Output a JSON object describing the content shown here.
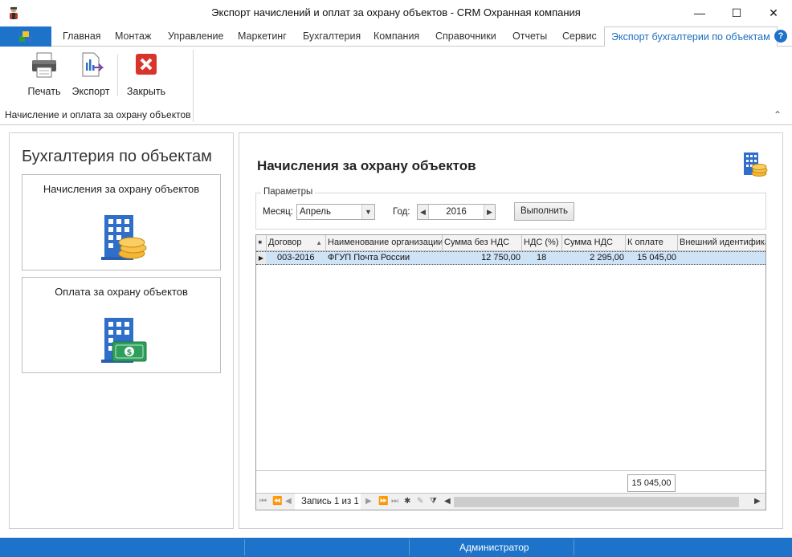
{
  "window": {
    "title": "Экспорт начислений и оплат за охрану объектов - CRM Охранная компания",
    "minimize_glyph": "—",
    "maximize_glyph": "☐",
    "close_glyph": "✕"
  },
  "tabs": [
    {
      "label": "Главная"
    },
    {
      "label": "Монтаж"
    },
    {
      "label": "Управление"
    },
    {
      "label": "Маркетинг"
    },
    {
      "label": "Бухгалтерия"
    },
    {
      "label": "Компания"
    },
    {
      "label": "Справочники"
    },
    {
      "label": "Отчеты"
    },
    {
      "label": "Сервис"
    },
    {
      "label": "Экспорт бухгалтерии по объектам",
      "active": true
    }
  ],
  "help_glyph": "?",
  "ribbon": {
    "print_label": "Печать",
    "export_label": "Экспорт",
    "close_label": "Закрыть",
    "group_label": "Начисление и оплата за охрану объектов",
    "collapse_glyph": "⌃"
  },
  "left_panel": {
    "title": "Бухгалтерия по объектам",
    "cards": [
      {
        "label": "Начисления за охрану объектов",
        "icon": "building-coins-icon"
      },
      {
        "label": "Оплата за охрану объектов",
        "icon": "building-cash-icon"
      }
    ]
  },
  "right_panel": {
    "title": "Начисления за охрану объектов",
    "params": {
      "legend": "Параметры",
      "month_label": "Месяц:",
      "month_value": "Апрель",
      "year_label": "Год:",
      "year_value": "2016",
      "run_label": "Выполнить"
    },
    "grid": {
      "columns": [
        "Договор",
        "Наименование организации",
        "Сумма без НДС",
        "НДС (%)",
        "Сумма НДС",
        "К оплате",
        "Внешний идентификатор"
      ],
      "rows": [
        {
          "contract": "003-2016",
          "organization": "ФГУП Почта России",
          "sum_no_vat": "12 750,00",
          "vat_pct": "18",
          "vat_sum": "2 295,00",
          "to_pay": "15 045,00",
          "external_id": ""
        }
      ],
      "total_to_pay": "15 045,00",
      "record_text": "Запись 1 из 1"
    }
  },
  "status": {
    "user": "Администратор"
  },
  "colors": {
    "accent": "#1c73c9",
    "selected_row": "#cfe3f7"
  }
}
